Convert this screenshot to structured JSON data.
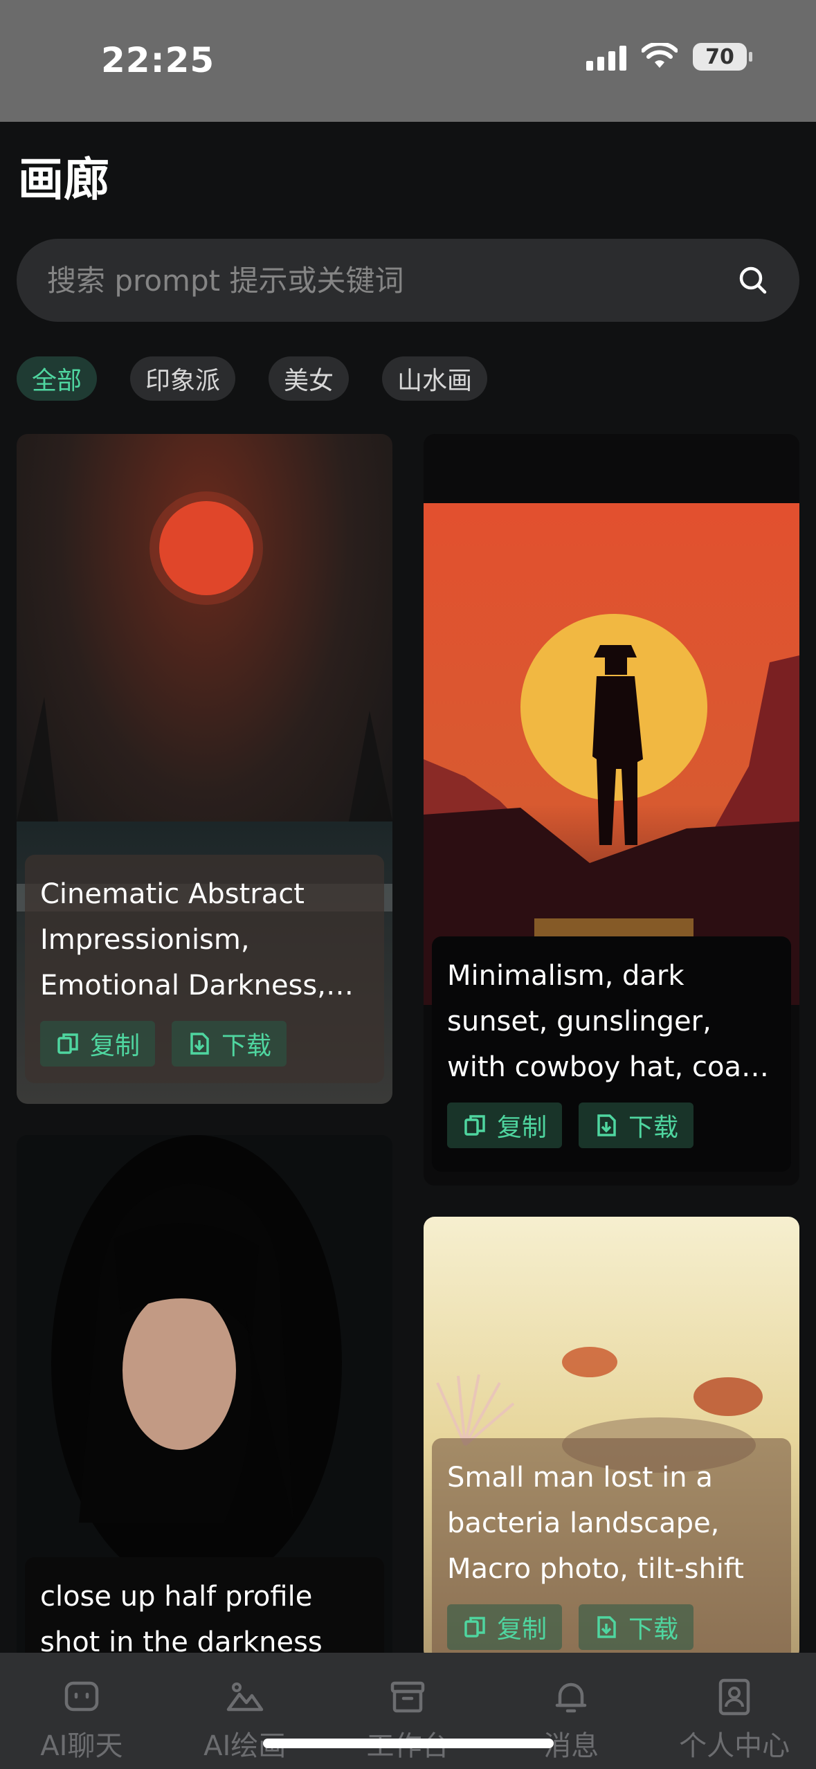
{
  "status": {
    "time": "22:25",
    "battery": "70"
  },
  "title": "画廊",
  "search": {
    "placeholder": "搜索 prompt 提示或关键词"
  },
  "chips": [
    {
      "label": "全部",
      "active": true
    },
    {
      "label": "印象派",
      "active": false
    },
    {
      "label": "美女",
      "active": false
    },
    {
      "label": "山水画",
      "active": false
    }
  ],
  "actions": {
    "copy": "复制",
    "download": "下载"
  },
  "cards": [
    {
      "caption": "Cinematic Abstract Impressionism, Emotional Darkness, fading dreams"
    },
    {
      "caption": "Minimalism, dark sunset, gunslinger, with cowboy hat, coat in the wind"
    },
    {
      "caption": "close up half profile shot in the darkness"
    },
    {
      "caption": "Small man lost in a bacteria landscape, Macro photo, tilt-shift"
    }
  ],
  "tabs": [
    {
      "label": "AI聊天",
      "icon": "chat-bot-icon"
    },
    {
      "label": "AI绘画",
      "icon": "mountain-image-icon"
    },
    {
      "label": "工作台",
      "icon": "archive-box-icon"
    },
    {
      "label": "消息",
      "icon": "bell-icon"
    },
    {
      "label": "个人中心",
      "icon": "profile-card-icon"
    }
  ],
  "colors": {
    "accent": "#4fd6a0",
    "background": "#101112",
    "surface": "#2b2c2e"
  }
}
